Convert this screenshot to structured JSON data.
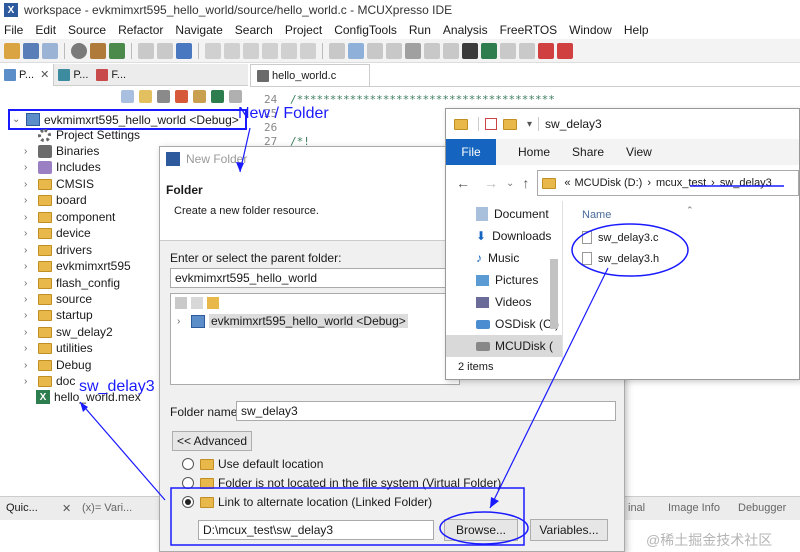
{
  "window": {
    "title": "workspace - evkmimxrt595_hello_world/source/hello_world.c - MCUXpresso IDE",
    "app_icon": "X"
  },
  "menu": [
    "File",
    "Edit",
    "Source",
    "Refactor",
    "Navigate",
    "Search",
    "Project",
    "ConfigTools",
    "Run",
    "Analysis",
    "FreeRTOS",
    "Window",
    "Help"
  ],
  "left_tabs": [
    {
      "label": "P...",
      "icon": "project-explorer-icon"
    },
    {
      "label": "P...",
      "icon": "peripherals-icon"
    },
    {
      "label": "F...",
      "icon": "faults-icon"
    }
  ],
  "tree": {
    "root": "evkmimxrt595_hello_world <Debug>",
    "items": [
      "Project Settings",
      "Binaries",
      "Includes",
      "CMSIS",
      "board",
      "component",
      "device",
      "drivers",
      "evkmimxrt595",
      "flash_config",
      "source",
      "startup",
      "sw_delay2",
      "utilities",
      "Debug",
      "doc",
      "hello_world.mex"
    ]
  },
  "editor": {
    "tab_label": "hello_world.c",
    "line_numbers": [
      "24",
      "25",
      "26",
      "27"
    ],
    "line_code": [
      "/***************************************",
      "",
      "",
      "/*!"
    ]
  },
  "dialog": {
    "title": "New Folder",
    "header_title": "Folder",
    "header_desc": "Create a new folder resource.",
    "parent_label": "Enter or select the parent folder:",
    "parent_value": "evkmimxrt595_hello_world",
    "tree_item": "evkmimxrt595_hello_world <Debug>",
    "folder_name_label": "Folder name:",
    "folder_name_value": "sw_delay3",
    "advanced_button": "<< Advanced",
    "radio_default": "Use default location",
    "radio_virtual": "Folder is not located in the file system (Virtual Folder)",
    "radio_linked": "Link to alternate location (Linked Folder)",
    "link_path": "D:\\mcux_test\\sw_delay3",
    "browse_button": "Browse...",
    "variables_button": "Variables..."
  },
  "explorer": {
    "title": "sw_delay3",
    "ribbon": {
      "file": "File",
      "tabs": [
        "Home",
        "Share",
        "View"
      ]
    },
    "breadcrumb": {
      "prefix": "«",
      "drive": "MCUDisk (D:)",
      "folder1": "mcux_test",
      "folder2": "sw_delay3"
    },
    "sidebar": [
      "Document",
      "Downloads",
      "Music",
      "Pictures",
      "Videos",
      "OSDisk (C:)",
      "MCUDisk ("
    ],
    "column_header": "Name",
    "files": [
      "sw_delay3.c",
      "sw_delay3.h"
    ],
    "status": "2 items"
  },
  "bottom": {
    "left_tabs": [
      "Quic...",
      "(x)= Vari..."
    ],
    "right_tabs": [
      "inal",
      "Image Info",
      "Debugger"
    ]
  },
  "annotations": {
    "new_folder": "New / Folder",
    "sw_delay3": "sw_delay3"
  },
  "watermark": "@稀土掘金技术社区",
  "colors": {
    "annotation": "#1a1aff",
    "file_tab": "#1565c0",
    "folder": "#e8b84a"
  }
}
